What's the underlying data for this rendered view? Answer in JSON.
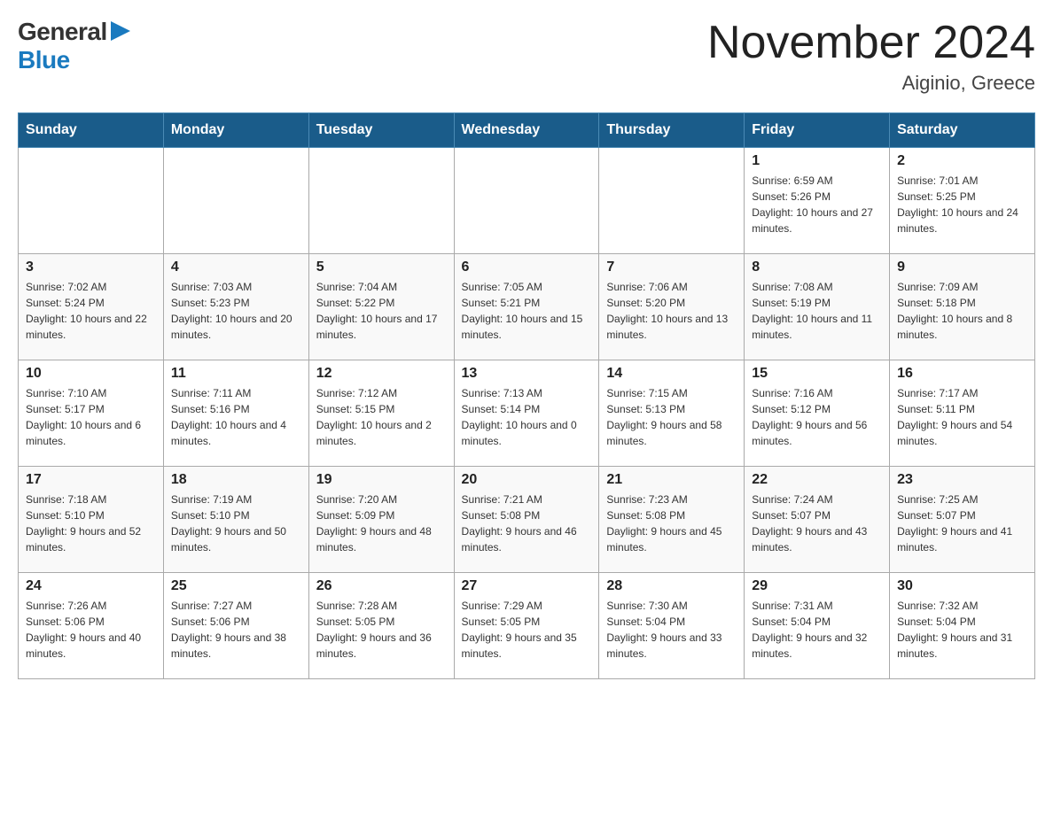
{
  "header": {
    "logo_general": "General",
    "logo_blue": "Blue",
    "month_title": "November 2024",
    "location": "Aiginio, Greece"
  },
  "weekdays": [
    "Sunday",
    "Monday",
    "Tuesday",
    "Wednesday",
    "Thursday",
    "Friday",
    "Saturday"
  ],
  "weeks": [
    [
      {
        "day": "",
        "sunrise": "",
        "sunset": "",
        "daylight": ""
      },
      {
        "day": "",
        "sunrise": "",
        "sunset": "",
        "daylight": ""
      },
      {
        "day": "",
        "sunrise": "",
        "sunset": "",
        "daylight": ""
      },
      {
        "day": "",
        "sunrise": "",
        "sunset": "",
        "daylight": ""
      },
      {
        "day": "",
        "sunrise": "",
        "sunset": "",
        "daylight": ""
      },
      {
        "day": "1",
        "sunrise": "Sunrise: 6:59 AM",
        "sunset": "Sunset: 5:26 PM",
        "daylight": "Daylight: 10 hours and 27 minutes."
      },
      {
        "day": "2",
        "sunrise": "Sunrise: 7:01 AM",
        "sunset": "Sunset: 5:25 PM",
        "daylight": "Daylight: 10 hours and 24 minutes."
      }
    ],
    [
      {
        "day": "3",
        "sunrise": "Sunrise: 7:02 AM",
        "sunset": "Sunset: 5:24 PM",
        "daylight": "Daylight: 10 hours and 22 minutes."
      },
      {
        "day": "4",
        "sunrise": "Sunrise: 7:03 AM",
        "sunset": "Sunset: 5:23 PM",
        "daylight": "Daylight: 10 hours and 20 minutes."
      },
      {
        "day": "5",
        "sunrise": "Sunrise: 7:04 AM",
        "sunset": "Sunset: 5:22 PM",
        "daylight": "Daylight: 10 hours and 17 minutes."
      },
      {
        "day": "6",
        "sunrise": "Sunrise: 7:05 AM",
        "sunset": "Sunset: 5:21 PM",
        "daylight": "Daylight: 10 hours and 15 minutes."
      },
      {
        "day": "7",
        "sunrise": "Sunrise: 7:06 AM",
        "sunset": "Sunset: 5:20 PM",
        "daylight": "Daylight: 10 hours and 13 minutes."
      },
      {
        "day": "8",
        "sunrise": "Sunrise: 7:08 AM",
        "sunset": "Sunset: 5:19 PM",
        "daylight": "Daylight: 10 hours and 11 minutes."
      },
      {
        "day": "9",
        "sunrise": "Sunrise: 7:09 AM",
        "sunset": "Sunset: 5:18 PM",
        "daylight": "Daylight: 10 hours and 8 minutes."
      }
    ],
    [
      {
        "day": "10",
        "sunrise": "Sunrise: 7:10 AM",
        "sunset": "Sunset: 5:17 PM",
        "daylight": "Daylight: 10 hours and 6 minutes."
      },
      {
        "day": "11",
        "sunrise": "Sunrise: 7:11 AM",
        "sunset": "Sunset: 5:16 PM",
        "daylight": "Daylight: 10 hours and 4 minutes."
      },
      {
        "day": "12",
        "sunrise": "Sunrise: 7:12 AM",
        "sunset": "Sunset: 5:15 PM",
        "daylight": "Daylight: 10 hours and 2 minutes."
      },
      {
        "day": "13",
        "sunrise": "Sunrise: 7:13 AM",
        "sunset": "Sunset: 5:14 PM",
        "daylight": "Daylight: 10 hours and 0 minutes."
      },
      {
        "day": "14",
        "sunrise": "Sunrise: 7:15 AM",
        "sunset": "Sunset: 5:13 PM",
        "daylight": "Daylight: 9 hours and 58 minutes."
      },
      {
        "day": "15",
        "sunrise": "Sunrise: 7:16 AM",
        "sunset": "Sunset: 5:12 PM",
        "daylight": "Daylight: 9 hours and 56 minutes."
      },
      {
        "day": "16",
        "sunrise": "Sunrise: 7:17 AM",
        "sunset": "Sunset: 5:11 PM",
        "daylight": "Daylight: 9 hours and 54 minutes."
      }
    ],
    [
      {
        "day": "17",
        "sunrise": "Sunrise: 7:18 AM",
        "sunset": "Sunset: 5:10 PM",
        "daylight": "Daylight: 9 hours and 52 minutes."
      },
      {
        "day": "18",
        "sunrise": "Sunrise: 7:19 AM",
        "sunset": "Sunset: 5:10 PM",
        "daylight": "Daylight: 9 hours and 50 minutes."
      },
      {
        "day": "19",
        "sunrise": "Sunrise: 7:20 AM",
        "sunset": "Sunset: 5:09 PM",
        "daylight": "Daylight: 9 hours and 48 minutes."
      },
      {
        "day": "20",
        "sunrise": "Sunrise: 7:21 AM",
        "sunset": "Sunset: 5:08 PM",
        "daylight": "Daylight: 9 hours and 46 minutes."
      },
      {
        "day": "21",
        "sunrise": "Sunrise: 7:23 AM",
        "sunset": "Sunset: 5:08 PM",
        "daylight": "Daylight: 9 hours and 45 minutes."
      },
      {
        "day": "22",
        "sunrise": "Sunrise: 7:24 AM",
        "sunset": "Sunset: 5:07 PM",
        "daylight": "Daylight: 9 hours and 43 minutes."
      },
      {
        "day": "23",
        "sunrise": "Sunrise: 7:25 AM",
        "sunset": "Sunset: 5:07 PM",
        "daylight": "Daylight: 9 hours and 41 minutes."
      }
    ],
    [
      {
        "day": "24",
        "sunrise": "Sunrise: 7:26 AM",
        "sunset": "Sunset: 5:06 PM",
        "daylight": "Daylight: 9 hours and 40 minutes."
      },
      {
        "day": "25",
        "sunrise": "Sunrise: 7:27 AM",
        "sunset": "Sunset: 5:06 PM",
        "daylight": "Daylight: 9 hours and 38 minutes."
      },
      {
        "day": "26",
        "sunrise": "Sunrise: 7:28 AM",
        "sunset": "Sunset: 5:05 PM",
        "daylight": "Daylight: 9 hours and 36 minutes."
      },
      {
        "day": "27",
        "sunrise": "Sunrise: 7:29 AM",
        "sunset": "Sunset: 5:05 PM",
        "daylight": "Daylight: 9 hours and 35 minutes."
      },
      {
        "day": "28",
        "sunrise": "Sunrise: 7:30 AM",
        "sunset": "Sunset: 5:04 PM",
        "daylight": "Daylight: 9 hours and 33 minutes."
      },
      {
        "day": "29",
        "sunrise": "Sunrise: 7:31 AM",
        "sunset": "Sunset: 5:04 PM",
        "daylight": "Daylight: 9 hours and 32 minutes."
      },
      {
        "day": "30",
        "sunrise": "Sunrise: 7:32 AM",
        "sunset": "Sunset: 5:04 PM",
        "daylight": "Daylight: 9 hours and 31 minutes."
      }
    ]
  ]
}
